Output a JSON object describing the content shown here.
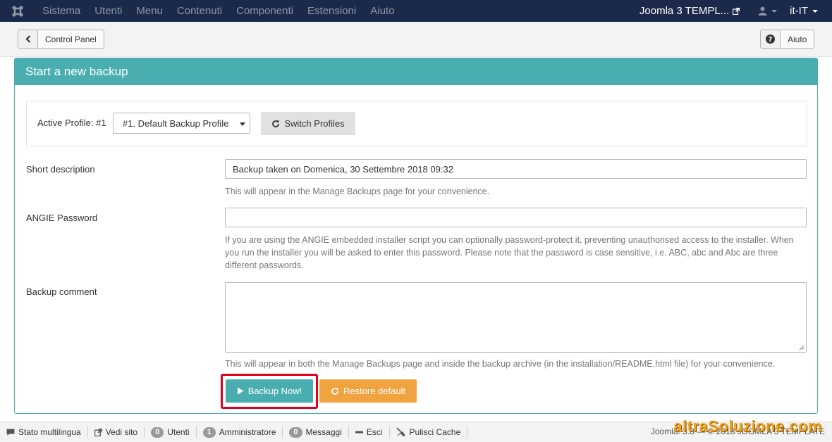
{
  "navbar": {
    "menu": [
      "Sistema",
      "Utenti",
      "Menu",
      "Contenuti",
      "Componenti",
      "Estensioni",
      "Aiuto"
    ],
    "site_name": "Joomla 3 TEMPL...",
    "language": "it-IT"
  },
  "toolbar": {
    "back_label": "Control Panel",
    "help_label": "Aiuto"
  },
  "panel": {
    "title": "Start a new backup",
    "profile": {
      "label": "Active Profile: #1",
      "selected": "#1. Default Backup Profile",
      "switch_label": "Switch Profiles"
    },
    "short_description": {
      "label": "Short description",
      "value": "Backup taken on Domenica, 30 Settembre 2018 09:32",
      "help": "This will appear in the Manage Backups page for your convenience."
    },
    "angie_password": {
      "label": "ANGIE Password",
      "value": "",
      "help": "If you are using the ANGIE embedded installer script you can optionally password-protect it, preventing unauthorised access to the installer. When you run the installer you will be asked to enter this password. Please note that the password is case sensitive, i.e. ABC, abc and Abc are three different passwords."
    },
    "backup_comment": {
      "label": "Backup comment",
      "value": "",
      "help": "This will appear in both the Manage Backups page and inside the backup archive (in the installation/README.html file) for your convenience."
    },
    "backup_now_label": "Backup Now!",
    "restore_default_label": "Restore default"
  },
  "statusbar": {
    "multilingual": "Stato multilingua",
    "view_site": "Vedi sito",
    "users_count": "0",
    "users_label": "Utenti",
    "admins_count": "1",
    "admins_label": "Amministratore",
    "messages_count": "0",
    "messages_label": "Messaggi",
    "logout": "Esci",
    "clear_cache": "Pulisci Cache",
    "copyright": "Joomla! 3.8 — © 2018 JOOMLA 3 TEMPLATE"
  },
  "watermark": "altraSoluzione.com",
  "colors": {
    "navbar": "#1b2a4a",
    "accent": "#4aaeb1",
    "warning": "#f0a33e",
    "highlight": "#e0001b"
  }
}
